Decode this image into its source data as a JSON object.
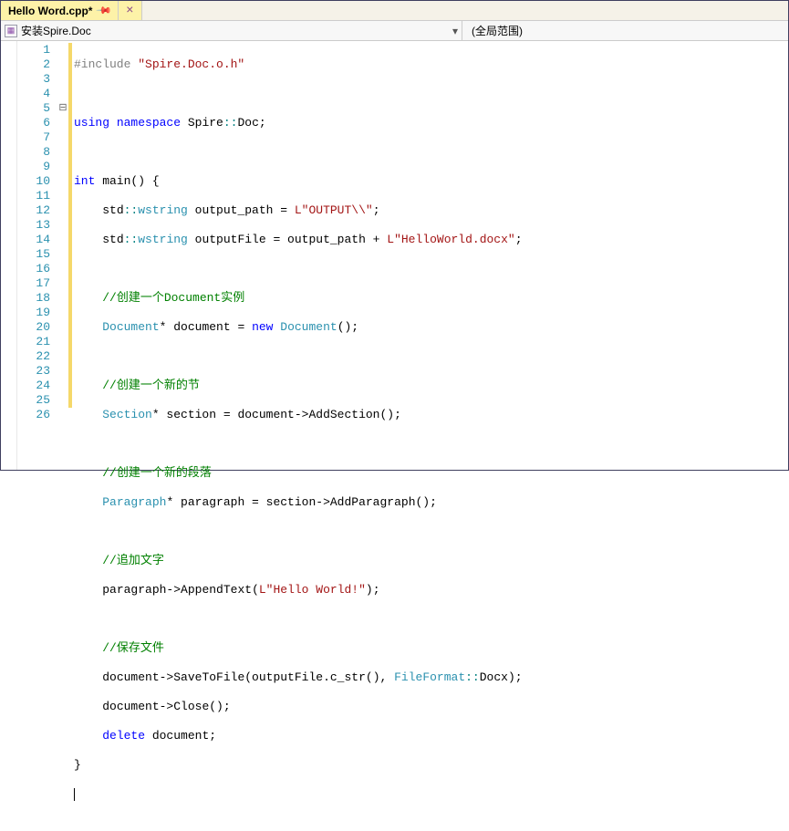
{
  "tab": {
    "title": "Hello Word.cpp*",
    "pinned": true
  },
  "nav": {
    "left": "安装Spire.Doc",
    "right": "(全局范围)"
  },
  "lines": [
    1,
    2,
    3,
    4,
    5,
    6,
    7,
    8,
    9,
    10,
    11,
    12,
    13,
    14,
    15,
    16,
    17,
    18,
    19,
    20,
    21,
    22,
    23,
    24,
    25,
    26
  ],
  "outline": {
    "5": "⊟"
  },
  "code": {
    "l1": {
      "pp": "#include ",
      "str": "\"Spire.Doc.o.h\""
    },
    "l3": {
      "kw1": "using",
      "kw2": "namespace",
      "txt": " Spire",
      "sym": "::",
      "txt2": "Doc;"
    },
    "l5": {
      "kw": "int",
      "fn": " main() {"
    },
    "l6": {
      "ind": "    ",
      "ns": "std",
      "c1": "::",
      "ty": "wstring",
      "v": " output_path = ",
      "s": "L\"OUTPUT\\\\\"",
      "e": ";"
    },
    "l7": {
      "ind": "    ",
      "ns": "std",
      "c1": "::",
      "ty": "wstring",
      "v": " outputFile = output_path + ",
      "s": "L\"HelloWorld.docx\"",
      "e": ";"
    },
    "l9": {
      "ind": "    ",
      "cm": "//创建一个Document实例"
    },
    "l10": {
      "ind": "    ",
      "ty": "Document",
      "t1": "* document = ",
      "kw": "new",
      "ty2": " Document",
      "t2": "();"
    },
    "l12": {
      "ind": "    ",
      "cm": "//创建一个新的节"
    },
    "l13": {
      "ind": "    ",
      "ty": "Section",
      "t1": "* section = document->",
      "m": "AddSection",
      "t2": "();"
    },
    "l15": {
      "ind": "    ",
      "cm": "//创建一个新的段落"
    },
    "l16": {
      "ind": "    ",
      "ty": "Paragraph",
      "t1": "* paragraph = section->",
      "m": "AddParagraph",
      "t2": "();"
    },
    "l18": {
      "ind": "    ",
      "cm": "//追加文字"
    },
    "l19": {
      "ind": "    ",
      "t1": "paragraph->",
      "m": "AppendText",
      "t2": "(",
      "s": "L\"Hello World!\"",
      "t3": ");"
    },
    "l21": {
      "ind": "    ",
      "cm": "//保存文件"
    },
    "l22": {
      "ind": "    ",
      "t1": "document->",
      "m": "SaveToFile",
      "t2": "(outputFile.",
      "m2": "c_str",
      "t3": "(), ",
      "ty": "FileFormat",
      "c1": "::",
      "en": "Docx",
      "t4": ");"
    },
    "l23": {
      "ind": "    ",
      "t1": "document->",
      "m": "Close",
      "t2": "();"
    },
    "l24": {
      "ind": "    ",
      "kw": "delete",
      "t1": " document;"
    },
    "l25": {
      "t": "}"
    }
  }
}
